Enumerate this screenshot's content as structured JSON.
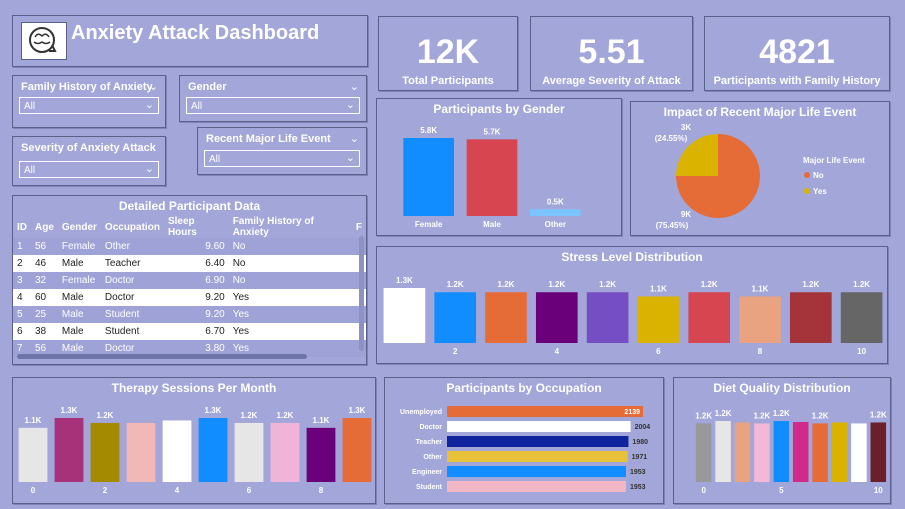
{
  "dashboard": {
    "title": "Anxiety Attack Dashboard"
  },
  "kpis": [
    {
      "value": "12K",
      "label": "Total Participants"
    },
    {
      "value": "5.51",
      "label": "Average Severity of Attack"
    },
    {
      "value": "4821",
      "label": "Participants with Family History"
    }
  ],
  "slicers": {
    "family_history": {
      "title": "Family History of Anxiety",
      "value": "All"
    },
    "gender": {
      "title": "Gender",
      "value": "All"
    },
    "severity": {
      "title": "Severity of Anxiety Attack",
      "value": "All"
    },
    "life_event": {
      "title": "Recent Major Life Event",
      "value": "All"
    }
  },
  "table": {
    "title": "Detailed Participant Data",
    "columns": [
      "ID",
      "Age",
      "Gender",
      "Occupation",
      "Sleep Hours",
      "Family History of Anxiety",
      "F"
    ],
    "rows": [
      [
        "1",
        "56",
        "Female",
        "Other",
        "9.60",
        "No"
      ],
      [
        "2",
        "46",
        "Male",
        "Teacher",
        "6.40",
        "No"
      ],
      [
        "3",
        "32",
        "Female",
        "Doctor",
        "6.90",
        "No"
      ],
      [
        "4",
        "60",
        "Male",
        "Doctor",
        "9.20",
        "Yes"
      ],
      [
        "5",
        "25",
        "Male",
        "Student",
        "9.20",
        "Yes"
      ],
      [
        "6",
        "38",
        "Male",
        "Student",
        "6.70",
        "Yes"
      ],
      [
        "7",
        "56",
        "Male",
        "Doctor",
        "3.80",
        "Yes"
      ]
    ]
  },
  "chart_data": [
    {
      "id": "gender",
      "type": "bar",
      "title": "Participants by Gender",
      "categories": [
        "Female",
        "Male",
        "Other"
      ],
      "values": [
        5800,
        5700,
        500
      ],
      "labels": [
        "5.8K",
        "5.7K",
        "0.5K"
      ],
      "colors": [
        "#118dff",
        "#d64550",
        "#7cc4ff"
      ],
      "ylim": [
        0,
        5800
      ]
    },
    {
      "id": "life_event",
      "type": "pie",
      "title": "Impact of Recent Major Life Event",
      "legend_title": "Major Life Event",
      "legend_position": "right",
      "slices": [
        {
          "name": "No",
          "value": 9000,
          "label": "9K",
          "percent_label": "(75.45%)",
          "color": "#e66c37"
        },
        {
          "name": "Yes",
          "value": 3000,
          "label": "3K",
          "percent_label": "(24.55%)",
          "color": "#d9b300"
        }
      ]
    },
    {
      "id": "stress",
      "type": "bar",
      "title": "Stress Level Distribution",
      "categories": [
        1,
        2,
        3,
        4,
        5,
        6,
        7,
        8,
        9,
        10
      ],
      "tick_labels": [
        "",
        "2",
        "",
        "4",
        "",
        "6",
        "",
        "8",
        "",
        "10"
      ],
      "values": [
        1300,
        1200,
        1200,
        1200,
        1200,
        1100,
        1200,
        1100,
        1200,
        1200
      ],
      "labels": [
        "1.3K",
        "1.2K",
        "1.2K",
        "1.2K",
        "1.2K",
        "1.1K",
        "1.2K",
        "1.1K",
        "1.2K",
        "1.2K"
      ],
      "colors": [
        "#ffffff",
        "#118dff",
        "#e66c37",
        "#6b007b",
        "#744ec2",
        "#d9b300",
        "#d64550",
        "#eaa380",
        "#a4343a",
        "#666666"
      ],
      "ylim": [
        0,
        1300
      ]
    },
    {
      "id": "therapy",
      "type": "bar",
      "title": "Therapy Sessions Per Month",
      "categories": [
        0,
        1,
        2,
        3,
        4,
        5,
        6,
        7,
        8,
        9
      ],
      "tick_labels": [
        "0",
        "",
        "2",
        "",
        "4",
        "",
        "6",
        "",
        "8",
        ""
      ],
      "values": [
        1100,
        1300,
        1200,
        1200,
        1250,
        1300,
        1200,
        1200,
        1100,
        1300
      ],
      "labels": [
        "1.1K",
        "1.3K",
        "1.2K",
        "",
        "",
        "1.3K",
        "1.2K",
        "1.2K",
        "1.1K",
        "1.3K"
      ],
      "colors": [
        "#e6e6e6",
        "#a83279",
        "#a38a00",
        "#f2b8b8",
        "#ffffff",
        "#118dff",
        "#e6e6e6",
        "#f0b4d8",
        "#6b007b",
        "#e66c37"
      ],
      "ylim": [
        0,
        1300
      ]
    },
    {
      "id": "occupation",
      "type": "bar",
      "orientation": "horizontal",
      "title": "Participants by Occupation",
      "categories": [
        "Unemployed",
        "Doctor",
        "Teacher",
        "Other",
        "Engineer",
        "Student"
      ],
      "values": [
        2139,
        2004,
        1980,
        1971,
        1953,
        1953
      ],
      "labels": [
        "2139",
        "2004",
        "1980",
        "1971",
        "1953",
        "1953"
      ],
      "colors": [
        "#e66c37",
        "#ffffff",
        "#12239e",
        "#e8c13a",
        "#118dff",
        "#f2b8c6"
      ],
      "xlim": [
        0,
        2139
      ]
    },
    {
      "id": "diet",
      "type": "bar",
      "title": "Diet Quality Distribution",
      "categories": [
        1,
        2,
        3,
        4,
        5,
        6,
        7,
        8,
        9,
        10
      ],
      "tick_labels": [
        "0",
        "",
        "",
        "",
        "5",
        "",
        "",
        "",
        "",
        "10"
      ],
      "values": [
        1200,
        1250,
        1220,
        1200,
        1250,
        1230,
        1200,
        1220,
        1200,
        1220
      ],
      "labels": [
        "1.2K",
        "1.2K",
        "",
        "1.2K",
        "1.2K",
        "",
        "1.2K",
        "",
        "",
        "1.2K"
      ],
      "colors": [
        "#999999",
        "#e6e6e6",
        "#eaa380",
        "#f2b8d8",
        "#118dff",
        "#d02b8a",
        "#e66c37",
        "#d9b300",
        "#ffffff",
        "#6b1f2b"
      ],
      "ylim": [
        0,
        1250
      ]
    }
  ]
}
